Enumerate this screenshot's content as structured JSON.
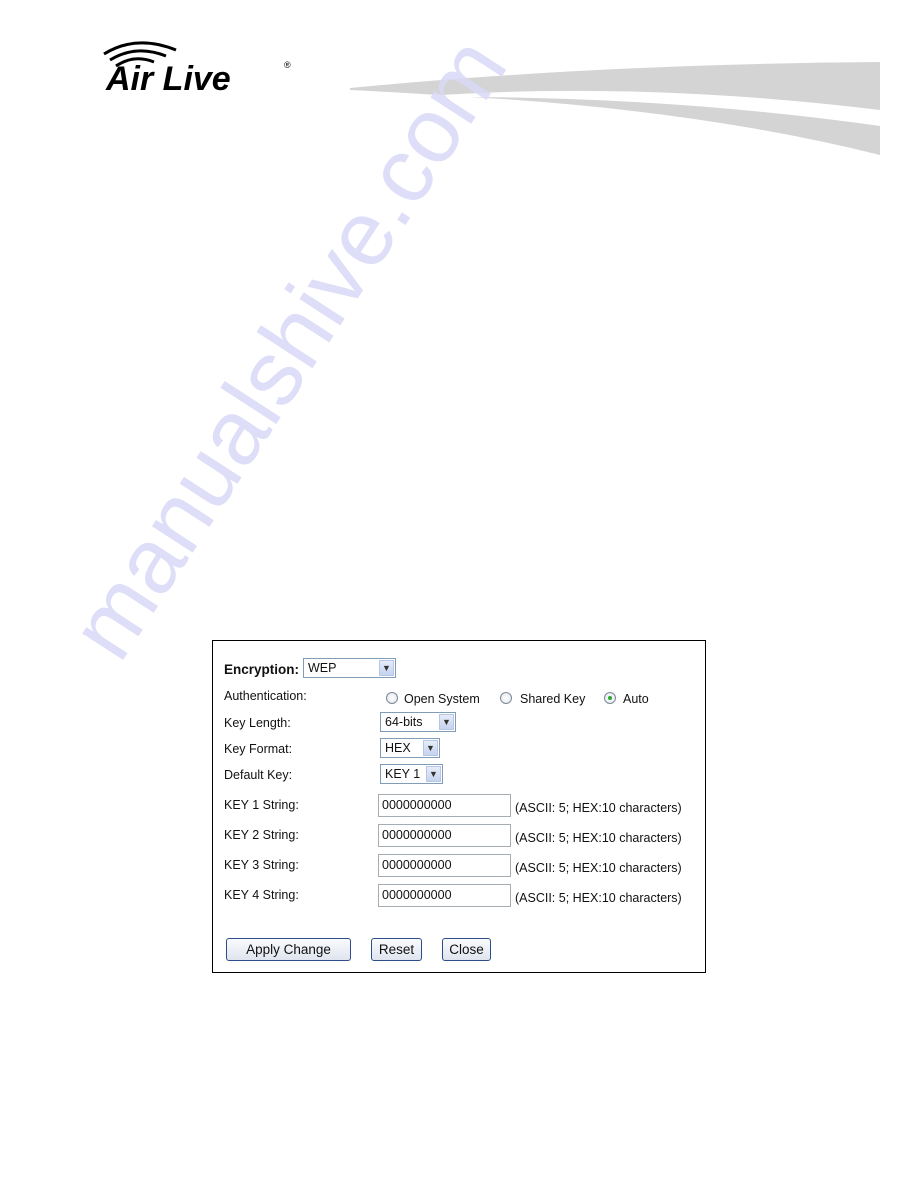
{
  "header": {
    "logo_text": "Air Live",
    "logo_mark": "®"
  },
  "watermark": "manualshive.com",
  "form": {
    "encryption": {
      "label": "Encryption:",
      "value": "WEP"
    },
    "authentication": {
      "label": "Authentication:",
      "options": [
        "Open System",
        "Shared Key",
        "Auto"
      ],
      "selected": "Auto"
    },
    "key_length": {
      "label": "Key Length:",
      "value": "64-bits"
    },
    "key_format": {
      "label": "Key Format:",
      "value": "HEX"
    },
    "default_key": {
      "label": "Default Key:",
      "value": "KEY 1"
    },
    "keys": [
      {
        "label": "KEY 1 String:",
        "value": "0000000000",
        "hint": "(ASCII: 5; HEX:10 characters)"
      },
      {
        "label": "KEY 2 String:",
        "value": "0000000000",
        "hint": "(ASCII: 5; HEX:10 characters)"
      },
      {
        "label": "KEY 3 String:",
        "value": "0000000000",
        "hint": "(ASCII: 5; HEX:10 characters)"
      },
      {
        "label": "KEY 4 String:",
        "value": "0000000000",
        "hint": "(ASCII: 5; HEX:10 characters)"
      }
    ],
    "buttons": {
      "apply": "Apply Change",
      "reset": "Reset",
      "close": "Close"
    }
  },
  "colors": {
    "swoosh": "#d4d4d4",
    "watermark": "#d9d9f7",
    "radio_selected": "#2ea82e"
  }
}
